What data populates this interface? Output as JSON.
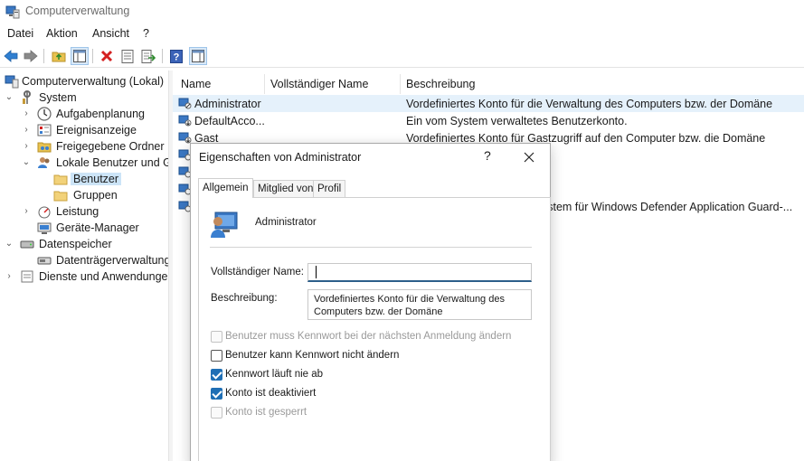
{
  "window": {
    "title": "Computerverwaltung"
  },
  "menu": [
    "Datei",
    "Aktion",
    "Ansicht",
    "?"
  ],
  "toolbar": {
    "buttons": [
      "back-arrow-icon",
      "forward-arrow-icon",
      "up-folder-icon",
      "show-hide-tree-icon",
      "delete-icon",
      "properties-icon",
      "export-list-icon",
      "help-icon",
      "show-hide-action-pane-icon"
    ]
  },
  "tree": {
    "root": "Computerverwaltung (Lokal)",
    "system": "System",
    "aufgabenplanung": "Aufgabenplanung",
    "ereignisanzeige": "Ereignisanzeige",
    "freigegebene": "Freigegebene Ordner",
    "lokale": "Lokale Benutzer und Gruppen",
    "benutzer": "Benutzer",
    "gruppen": "Gruppen",
    "leistung": "Leistung",
    "geraete": "Geräte-Manager",
    "datenspeicher": "Datenspeicher",
    "datentraeger": "Datenträgerverwaltung",
    "dienste": "Dienste und Anwendungen"
  },
  "list": {
    "columns": [
      "Name",
      "Vollständiger Name",
      "Beschreibung"
    ],
    "rows": [
      {
        "name": "Administrator",
        "fullname": "",
        "description": "Vordefiniertes Konto für die Verwaltung des Computers bzw. der Domäne"
      },
      {
        "name": "DefaultAcco...",
        "fullname": "",
        "description": "Ein vom System verwaltetes Benutzerkonto."
      },
      {
        "name": "Gast",
        "fullname": "",
        "description": "Vordefiniertes Konto für Gastzugriff auf den Computer bzw. die Domäne"
      },
      {
        "name": "",
        "fullname": "",
        "description": ""
      },
      {
        "name": "",
        "fullname": "",
        "description": ""
      },
      {
        "name": "",
        "fullname": "",
        "description": ""
      },
      {
        "name": "",
        "fullname": "",
        "description": "ystem für Windows Defender Application Guard-..."
      }
    ]
  },
  "dialog": {
    "title": "Eigenschaften von Administrator",
    "help": "?",
    "tabs": [
      "Allgemein",
      "Mitglied von",
      "Profil"
    ],
    "username": "Administrator",
    "fullname_label": "Vollständiger Name:",
    "fullname_value": "",
    "description_label": "Beschreibung:",
    "description_value": "Vordefiniertes Konto für die Verwaltung des Computers bzw. der Domäne",
    "checkboxes": {
      "must_change": "Benutzer muss Kennwort bei der nächsten Anmeldung ändern",
      "cannot_change": "Benutzer kann Kennwort nicht ändern",
      "never_expires": "Kennwort läuft nie ab",
      "disabled": "Konto ist deaktiviert",
      "locked": "Konto ist gesperrt"
    }
  }
}
